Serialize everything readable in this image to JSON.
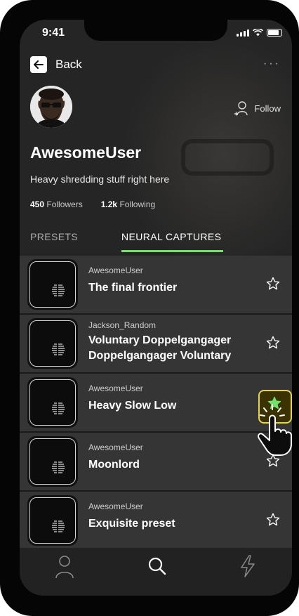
{
  "status_bar": {
    "time": "9:41"
  },
  "header": {
    "back_label": "Back",
    "more_label": "···"
  },
  "profile": {
    "username": "AwesomeUser",
    "bio": "Heavy shredding stuff right here",
    "followers_count": "450",
    "followers_label": "Followers",
    "following_count": "1.2k",
    "following_label": "Following",
    "follow_label": "Follow"
  },
  "tabs": [
    {
      "label": "PRESETS",
      "active": false
    },
    {
      "label": "NEURAL CAPTURES",
      "active": true
    }
  ],
  "presets": [
    {
      "user": "AwesomeUser",
      "title": "The final frontier",
      "starred": false
    },
    {
      "user": "Jackson_Random",
      "title": "Voluntary Doppelgangager Doppelgangager Voluntary",
      "starred": false
    },
    {
      "user": "AwesomeUser",
      "title": "Heavy Slow Low",
      "starred": true
    },
    {
      "user": "AwesomeUser",
      "title": "Moonlord",
      "starred": false
    },
    {
      "user": "AwesomeUser",
      "title": "Exquisite preset",
      "starred": false
    }
  ],
  "bottom_nav": [
    {
      "icon": "profile-icon",
      "active": false
    },
    {
      "icon": "search-icon",
      "active": true
    },
    {
      "icon": "lightning-icon",
      "active": false
    }
  ],
  "colors": {
    "accent": "#74e26b",
    "highlight": "#e6d44a",
    "background": "#252525"
  }
}
